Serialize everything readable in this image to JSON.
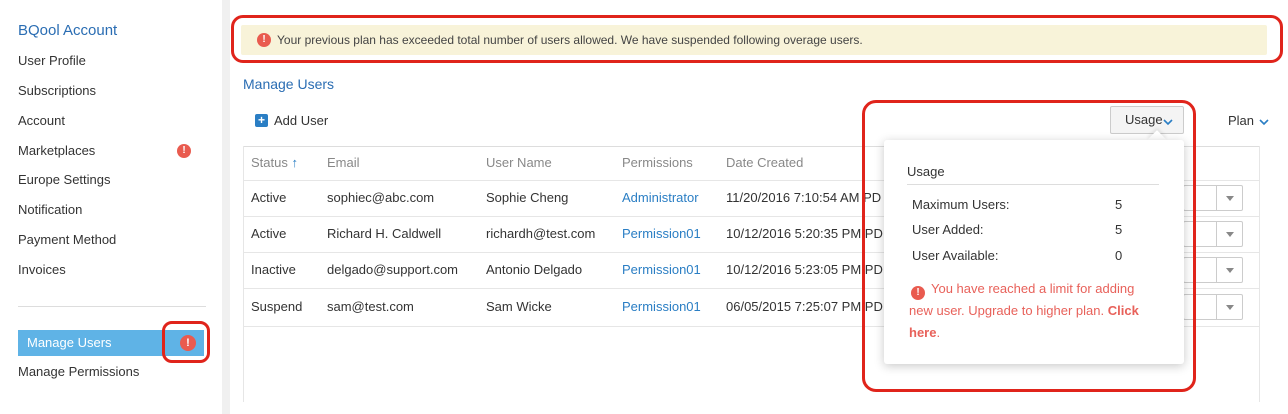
{
  "sidebar": {
    "title": "BQool Account",
    "items": [
      {
        "label": "User Profile"
      },
      {
        "label": "Subscriptions"
      },
      {
        "label": "Account"
      },
      {
        "label": "Marketplaces",
        "alert": "!"
      },
      {
        "label": "Europe Settings"
      },
      {
        "label": "Notification"
      },
      {
        "label": "Payment Method"
      },
      {
        "label": "Invoices"
      }
    ],
    "active_item": {
      "label": "Manage Users",
      "alert": "!"
    },
    "manage_permissions": "Manage Permissions"
  },
  "banner": {
    "icon": "alert-icon",
    "icon_glyph": "!",
    "text": "Your previous plan has exceeded total number of users allowed. We have suspended following overage users."
  },
  "main": {
    "title": "Manage Users",
    "add_user_label": "Add User",
    "add_user_glyph": "+",
    "usage_button": "Usage",
    "plan_button": "Plan",
    "columns": [
      "Status",
      "Email",
      "User Name",
      "Permissions",
      "Date Created"
    ],
    "sort_glyph": "↑",
    "rows": [
      {
        "status": "Active",
        "email": "sophiec@abc.com",
        "user_name": "Sophie Cheng",
        "permissions": "Administrator",
        "date": "11/20/2016 7:10:54 AM PD"
      },
      {
        "status": "Active",
        "email": "Richard H. Caldwell",
        "user_name": "richardh@test.com",
        "permissions": "Permission01",
        "date": "10/12/2016 5:20:35 PM PD"
      },
      {
        "status": "Inactive",
        "email": "delgado@support.com",
        "user_name": "Antonio Delgado",
        "permissions": "Permission01",
        "date": "10/12/2016 5:23:05 PM PD"
      },
      {
        "status": "Suspend",
        "email": "sam@test.com",
        "user_name": "Sam Wicke",
        "permissions": "Permission01",
        "date": "06/05/2015 7:25:07 PM PD"
      }
    ]
  },
  "usage_popover": {
    "title": "Usage",
    "stats": [
      {
        "label": "Maximum Users:",
        "value": "5"
      },
      {
        "label": "User Added:",
        "value": "5"
      },
      {
        "label": "User Available:",
        "value": "0"
      }
    ],
    "message_prefix": "You have reached a limit for adding new user. Upgrade to higher plan. ",
    "message_link": "Click here",
    "message_suffix": "."
  },
  "colors": {
    "accent": "#2a6db3",
    "alert": "#e95b4f",
    "annotation": "#e0241b",
    "banner_bg": "#f8f3d9",
    "active_bg": "#5fb3e6"
  }
}
